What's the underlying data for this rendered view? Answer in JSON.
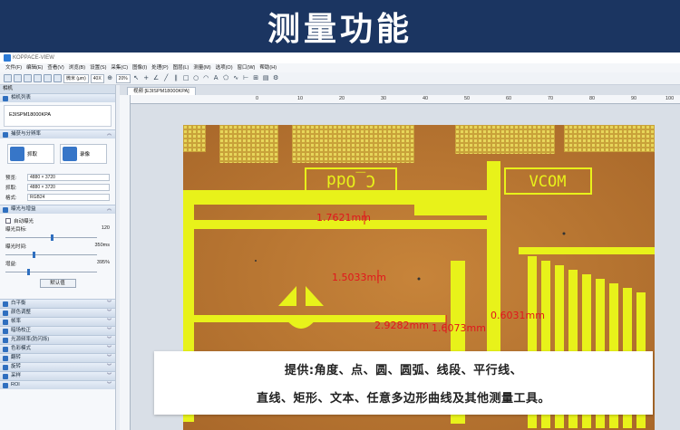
{
  "banner": {
    "title": "测量功能"
  },
  "app": {
    "title": "KOPPACE-VIEW",
    "menu": [
      "文件(F)",
      "编辑(E)",
      "查看(V)",
      "浏览(B)",
      "设置(S)",
      "采集(C)",
      "图像(I)",
      "处理(P)",
      "图层(L)",
      "测量(M)",
      "选项(O)",
      "窗口(W)",
      "帮助(H)"
    ],
    "toolbar": {
      "unit": "微米 (μm)",
      "magnification": "40X",
      "zoom": "20%"
    },
    "tab": "视频 [E3ISPM18000KPA]",
    "ruler": [
      "0",
      "10",
      "20",
      "30",
      "40",
      "50",
      "60",
      "70",
      "80",
      "90",
      "100"
    ]
  },
  "sidebar": {
    "header": "相机",
    "camera_list_label": "相机列表",
    "camera_name": "E3ISPM18000KPA",
    "capture_section": "捕获与分辨率",
    "snap_label": "抓取",
    "record_label": "录像",
    "fields": [
      {
        "label": "预览:",
        "value": "4880 × 3720"
      },
      {
        "label": "抓取:",
        "value": "4880 × 3720"
      },
      {
        "label": "格式:",
        "value": "RGB24"
      }
    ],
    "exposure_section": "曝光与增益",
    "auto_exposure": "自动曝光",
    "exposure_target_label": "曝光目标:",
    "exposure_target_value": "120",
    "exposure_time_label": "曝光时间:",
    "exposure_time_value": "350ms",
    "gain_label": "增益:",
    "gain_value": "395%",
    "default_button": "默认值",
    "sections": [
      "白平衡",
      "颜色调整",
      "帧率",
      "暗场校正",
      "光源频率(防闪烁)",
      "色彩模式",
      "翻转",
      "旋转",
      "采样",
      "ROI"
    ]
  },
  "measurements": [
    "1.7621mm",
    "1.5033mm",
    "2.9282mm",
    "1.6073mm",
    "0.6031mm"
  ],
  "image_text": {
    "pad_left": "C_Odd",
    "pad_right": "VCOM"
  },
  "info": {
    "line1": "提供:角度、点、圆、圆弧、线段、平行线、",
    "line2": "直线、矩形、文本、任意多边形曲线及其他测量工具。"
  },
  "colors": {
    "banner": "#1b3561",
    "measure": "#e2151c",
    "trace": "#e8f21a"
  }
}
